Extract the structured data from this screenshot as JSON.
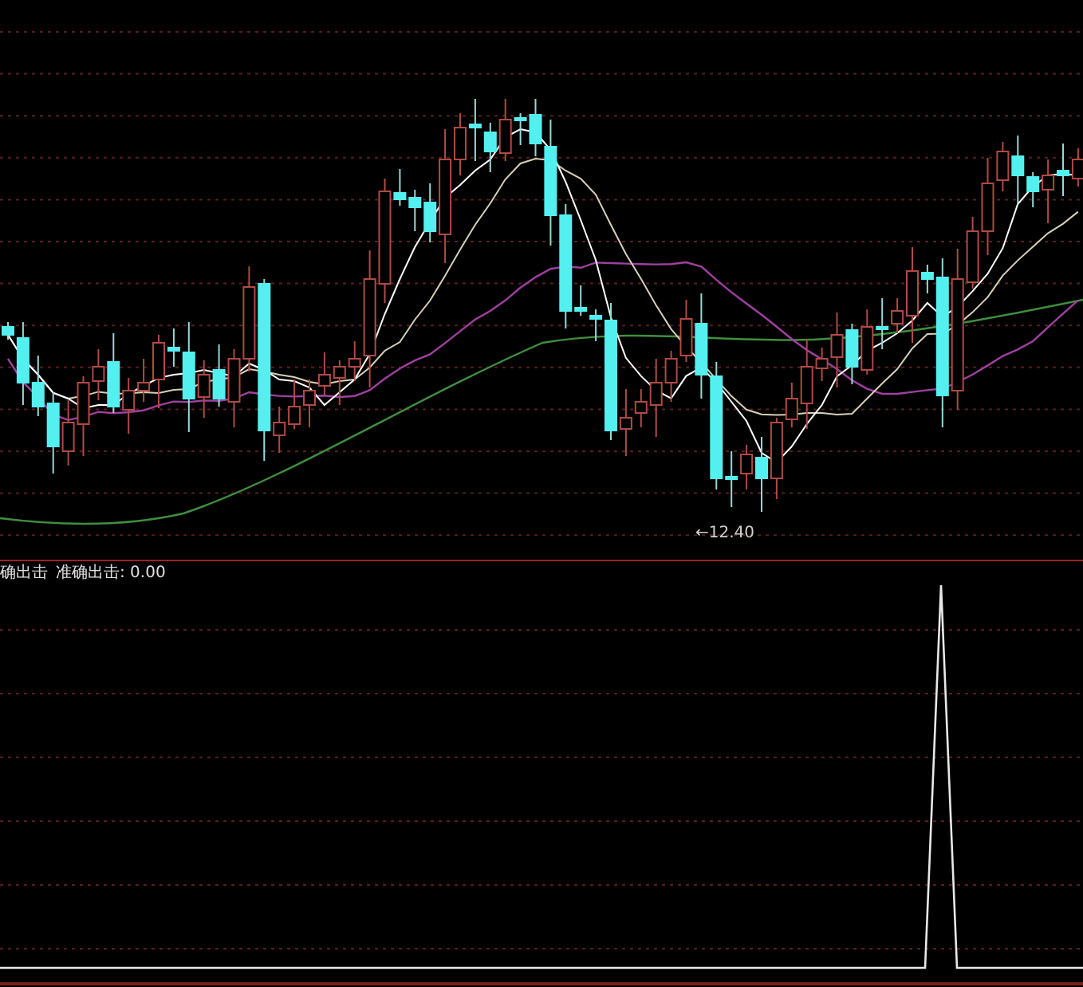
{
  "price_chart": {
    "low_marker": "←12.40"
  },
  "indicator_panel": {
    "name_label": "确出击",
    "value_label": "准确出击: 0.00"
  }
}
